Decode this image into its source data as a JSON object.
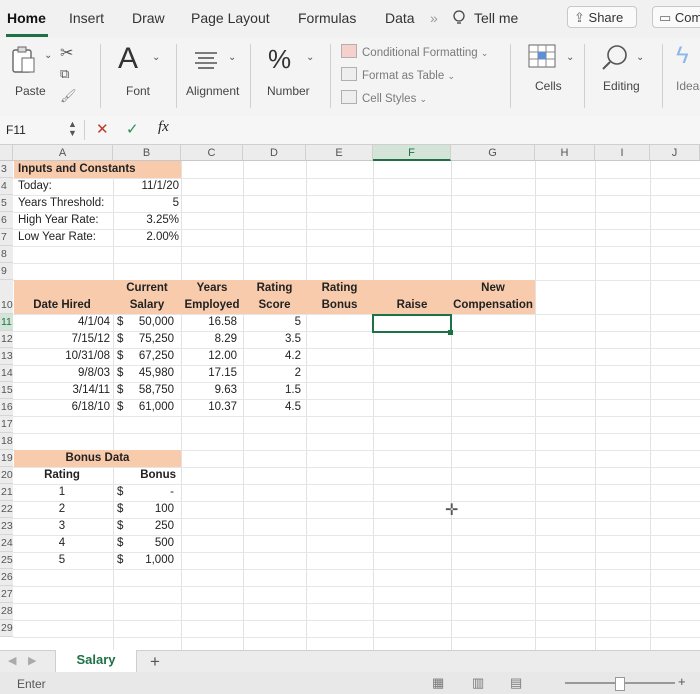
{
  "tabs": {
    "items": [
      "Home",
      "Insert",
      "Draw",
      "Page Layout",
      "Formulas",
      "Data"
    ],
    "more": "»",
    "tell_me": "Tell me",
    "share": "Share",
    "comments": "Com"
  },
  "ribbon": {
    "paste": "Paste",
    "font": "Font",
    "alignment": "Alignment",
    "number": "Number",
    "conditional_formatting": "Conditional Formatting",
    "format_as_table": "Format as Table",
    "cell_styles": "Cell Styles",
    "cells": "Cells",
    "editing": "Editing",
    "ideas": "Ideas",
    "font_glyph": "A",
    "number_glyph": "%"
  },
  "formula_bar": {
    "name_box": "F11",
    "cancel": "✕",
    "enter": "✓",
    "fx": "fx",
    "value": ""
  },
  "columns": [
    "A",
    "B",
    "C",
    "D",
    "E",
    "F",
    "G",
    "H",
    "I",
    "J"
  ],
  "rows": [
    "3",
    "4",
    "5",
    "6",
    "7",
    "8",
    "9",
    "10",
    "11",
    "12",
    "13",
    "14",
    "15",
    "16",
    "17",
    "18",
    "19",
    "20",
    "21",
    "22",
    "23",
    "24",
    "25",
    "26",
    "27",
    "28",
    "29"
  ],
  "inputs": {
    "title": "Inputs and Constants",
    "today_label": "Today:",
    "today_value": "11/1/20",
    "years_label": "Years Threshold:",
    "years_value": "5",
    "high_label": "High Year Rate:",
    "high_value": "3.25%",
    "low_label": "Low Year Rate:",
    "low_value": "2.00%"
  },
  "table": {
    "headers": {
      "date_hired": "Date Hired",
      "current": "Current",
      "salary": "Salary",
      "years": "Years",
      "employed": "Employed",
      "rating": "Rating",
      "score": "Score",
      "rating2": "Rating",
      "bonus": "Bonus",
      "raise": "Raise",
      "new": "New",
      "compensation": "Compensation"
    },
    "rows": [
      {
        "date": "4/1/04",
        "cur": "$",
        "salary": "50,000",
        "years": "16.58",
        "score": "5"
      },
      {
        "date": "7/15/12",
        "cur": "$",
        "salary": "75,250",
        "years": "8.29",
        "score": "3.5"
      },
      {
        "date": "10/31/08",
        "cur": "$",
        "salary": "67,250",
        "years": "12.00",
        "score": "4.2"
      },
      {
        "date": "9/8/03",
        "cur": "$",
        "salary": "45,980",
        "years": "17.15",
        "score": "2"
      },
      {
        "date": "3/14/11",
        "cur": "$",
        "salary": "58,750",
        "years": "9.63",
        "score": "1.5"
      },
      {
        "date": "6/18/10",
        "cur": "$",
        "salary": "61,000",
        "years": "10.37",
        "score": "4.5"
      }
    ]
  },
  "bonus_data": {
    "title": "Bonus Data",
    "rating_header": "Rating",
    "bonus_header": "Bonus",
    "rows": [
      {
        "rating": "1",
        "cur": "$",
        "bonus": "-"
      },
      {
        "rating": "2",
        "cur": "$",
        "bonus": "100"
      },
      {
        "rating": "3",
        "cur": "$",
        "bonus": "250"
      },
      {
        "rating": "4",
        "cur": "$",
        "bonus": "500"
      },
      {
        "rating": "5",
        "cur": "$",
        "bonus": "1,000"
      }
    ]
  },
  "sheet_tabs": {
    "active": "Salary",
    "add": "+"
  },
  "status": {
    "mode": "Enter"
  }
}
